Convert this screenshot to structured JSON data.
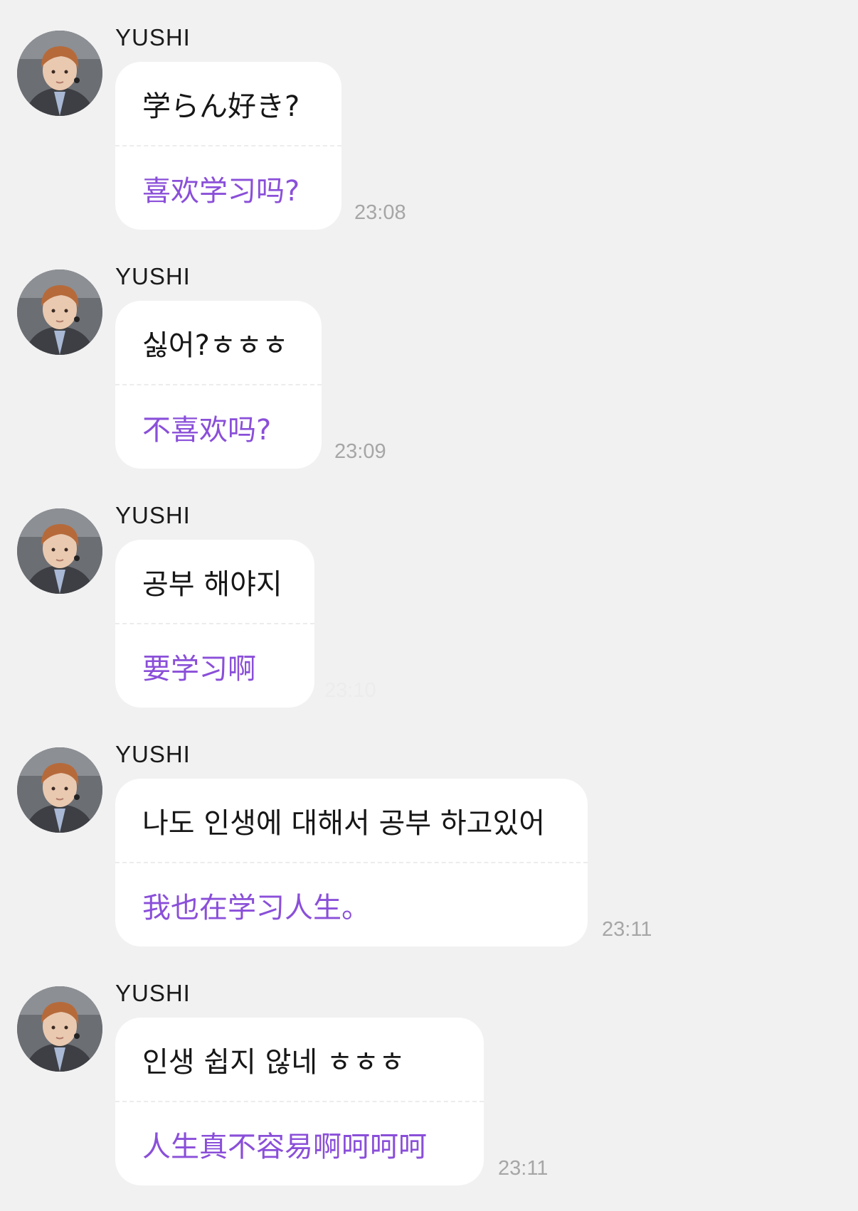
{
  "messages": [
    {
      "sender": "YUSHI",
      "original": "学らん好き?",
      "translation": "喜欢学习吗?",
      "time": "23:08"
    },
    {
      "sender": "YUSHI",
      "original": "싫어?ㅎㅎㅎ",
      "translation": "不喜欢吗?",
      "time": "23:09"
    },
    {
      "sender": "YUSHI",
      "original": "공부 해야지",
      "translation": "要学习啊",
      "time": "23:10"
    },
    {
      "sender": "YUSHI",
      "original": "나도 인생에 대해서 공부 하고있어",
      "translation": "我也在学习人生。",
      "time": "23:11"
    },
    {
      "sender": "YUSHI",
      "original": "인생 쉽지 않네 ㅎㅎㅎ",
      "translation": "人生真不容易啊呵呵呵",
      "time": "23:11"
    }
  ],
  "colors": {
    "background": "#f1f1f1",
    "bubble": "#ffffff",
    "translation_text": "#8a4fd9",
    "time_text": "#a6a6a6"
  },
  "icons": {
    "avatar": "profile-photo"
  }
}
